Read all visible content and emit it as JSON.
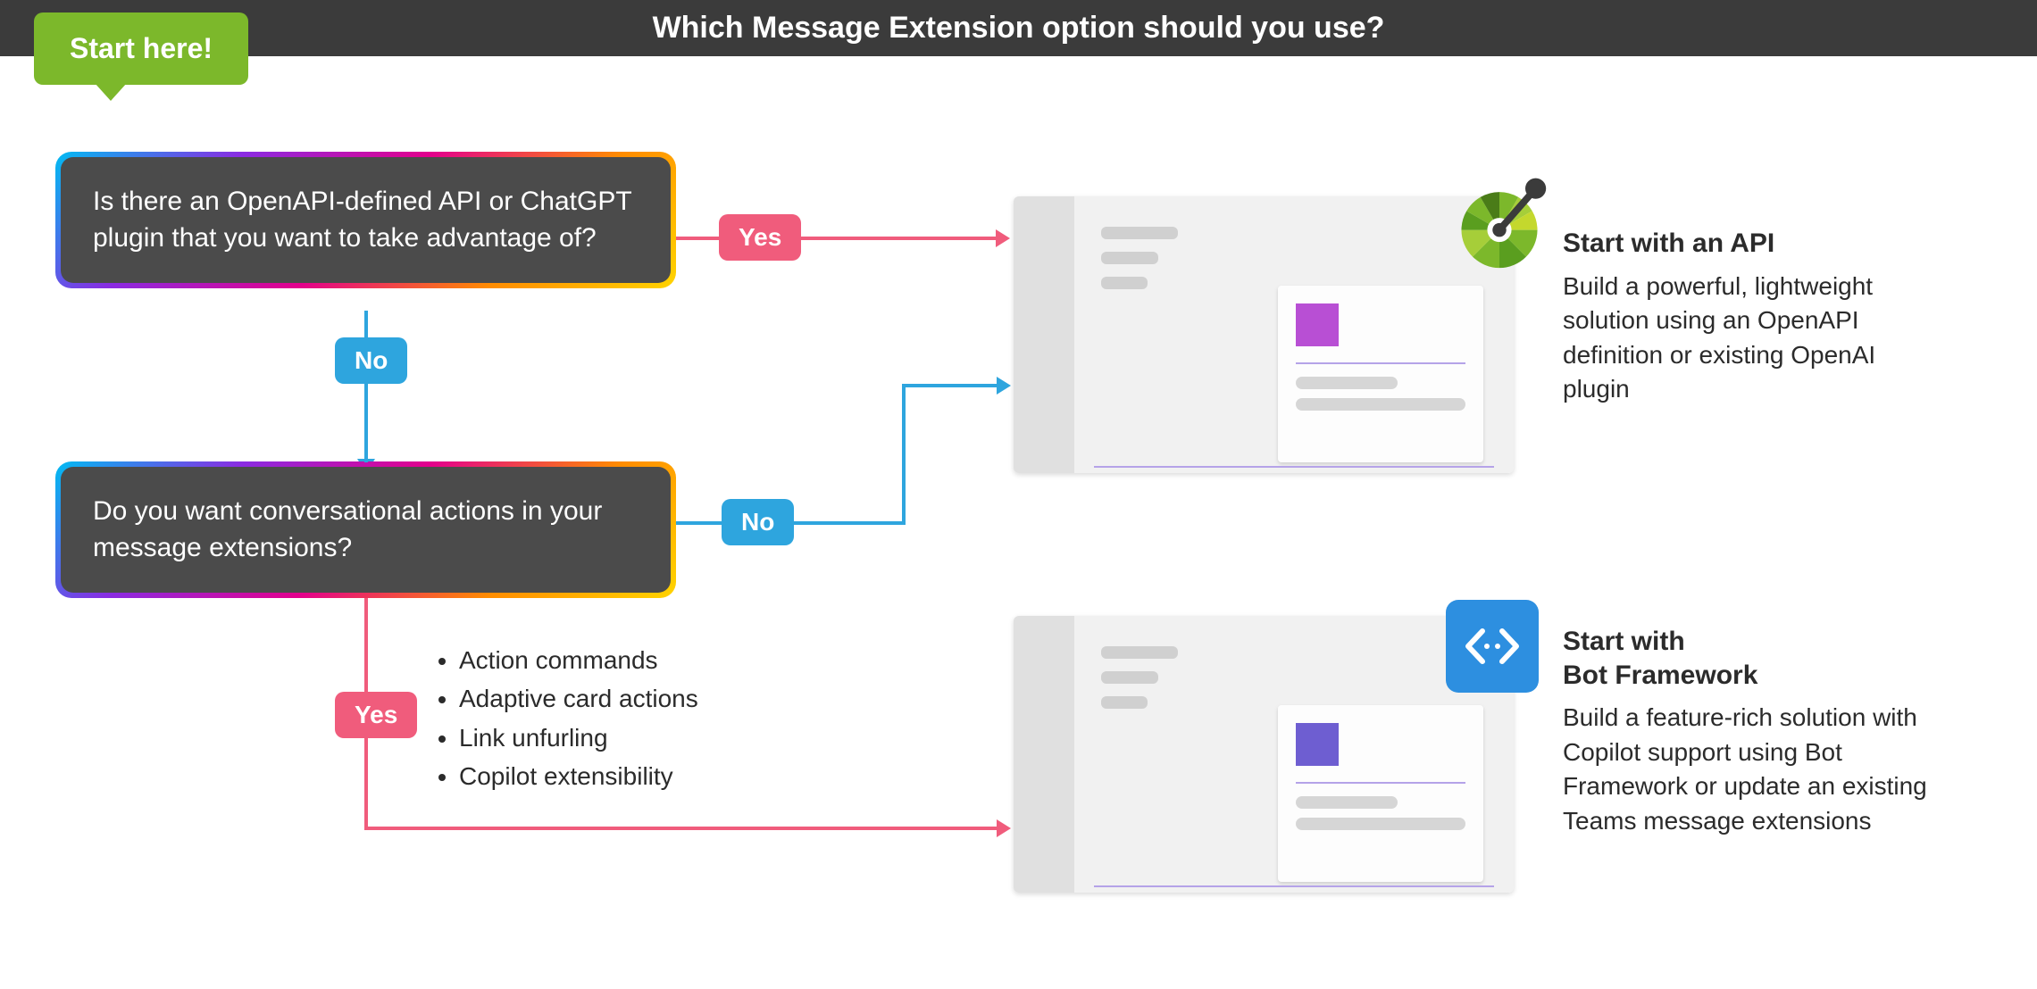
{
  "header": {
    "title": "Which Message Extension option should you use?"
  },
  "start": {
    "label": "Start here!"
  },
  "decisions": {
    "d1": "Is there an OpenAPI-defined API or ChatGPT plugin that you want to take advantage of?",
    "d2": "Do you want conversational actions in your message extensions?"
  },
  "labels": {
    "yes": "Yes",
    "no": "No"
  },
  "bullets": [
    "Action commands",
    "Adaptive card actions",
    "Link unfurling",
    "Copilot extensibility"
  ],
  "results": {
    "api": {
      "heading": "Start with an API",
      "body": "Build a powerful, lightweight solution using an OpenAPI definition or existing OpenAI plugin"
    },
    "bot": {
      "heading": "Start with\nBot Framework",
      "body": "Build a feature-rich solution with Copilot support using Bot Framework or update an existing Teams message extensions"
    }
  },
  "colors": {
    "yesArrow": "#f05c7c",
    "noArrow": "#2ea5de",
    "startBadge": "#7cb82b",
    "codeBadge": "#2d8fe0"
  }
}
